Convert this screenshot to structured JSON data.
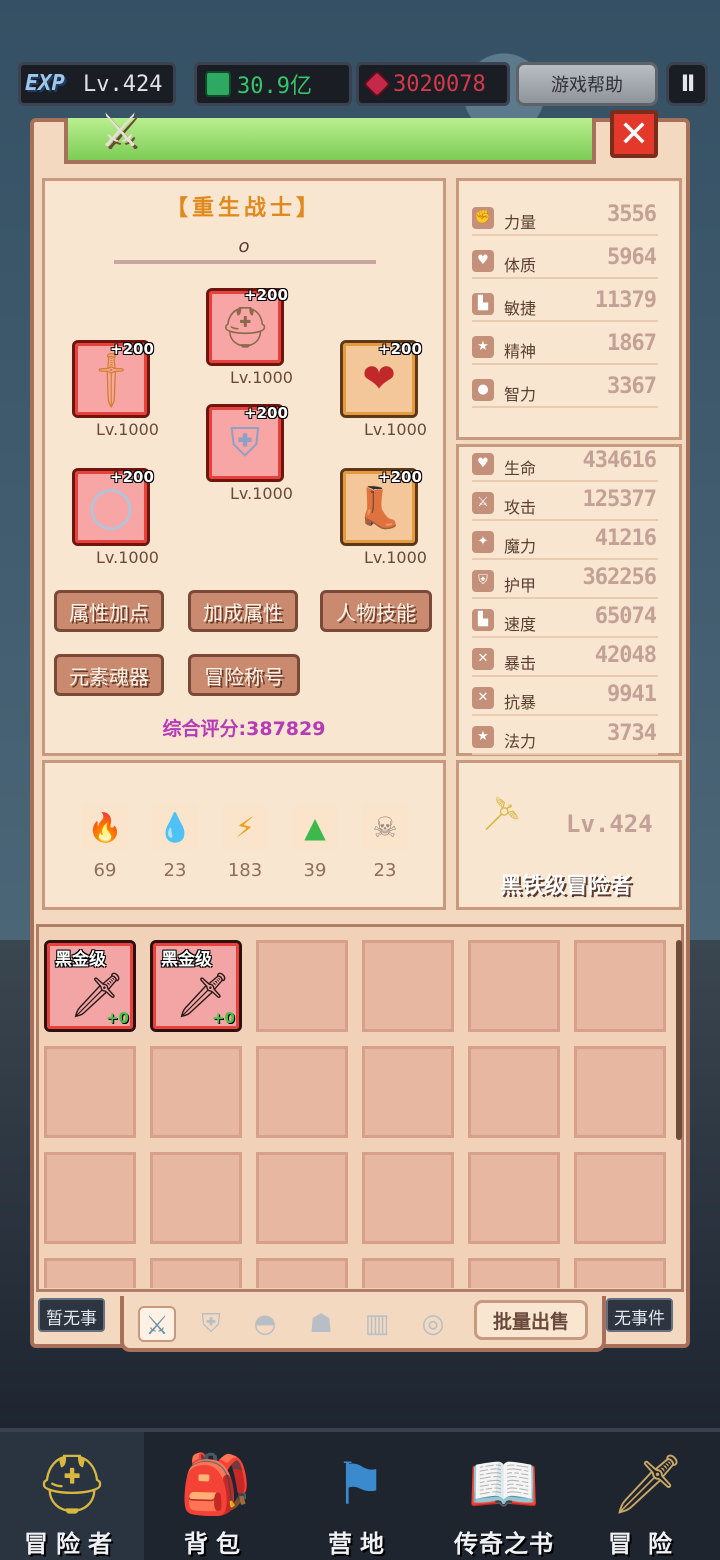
{
  "topbar": {
    "exp_badge": "EXP",
    "level": "Lv.424",
    "green_currency": "30.9亿",
    "red_currency": "3020078",
    "help_label": "游戏帮助",
    "pause_label": "II"
  },
  "panel": {
    "close_label": "✕"
  },
  "character": {
    "class_title": "【重生战士】",
    "subtitle": "o",
    "score_label": "综合评分:387829"
  },
  "equipment": [
    {
      "plus": "+200",
      "level": "Lv.1000",
      "icon": "helmet-icon"
    },
    {
      "plus": "+200",
      "level": "Lv.1000",
      "icon": "sword-icon"
    },
    {
      "plus": "+200",
      "level": "Lv.1000",
      "icon": "amulet-icon"
    },
    {
      "plus": "+200",
      "level": "Lv.1000",
      "icon": "armor-icon"
    },
    {
      "plus": "+200",
      "level": "Lv.1000",
      "icon": "ring-icon"
    },
    {
      "plus": "+200",
      "level": "Lv.1000",
      "icon": "boots-icon"
    }
  ],
  "actions": [
    "属性加点",
    "加成属性",
    "人物技能",
    "元素魂器",
    "冒险称号"
  ],
  "elements": [
    {
      "icon": "fire-icon",
      "value": "69",
      "color": "#e8421f"
    },
    {
      "icon": "water-icon",
      "value": "23",
      "color": "#3a9de0"
    },
    {
      "icon": "lightning-icon",
      "value": "183",
      "color": "#f0a020"
    },
    {
      "icon": "earth-icon",
      "value": "39",
      "color": "#3cb94a"
    },
    {
      "icon": "skull-icon",
      "value": "23",
      "color": "#9a8a80"
    }
  ],
  "attributes": [
    {
      "label": "力量",
      "value": "3556"
    },
    {
      "label": "体质",
      "value": "5964"
    },
    {
      "label": "敏捷",
      "value": "11379"
    },
    {
      "label": "精神",
      "value": "1867"
    },
    {
      "label": "智力",
      "value": "3367"
    }
  ],
  "combat_stats": [
    {
      "label": "生命",
      "value": "434616"
    },
    {
      "label": "攻击",
      "value": "125377"
    },
    {
      "label": "魔力",
      "value": "41216"
    },
    {
      "label": "护甲",
      "value": "362256"
    },
    {
      "label": "速度",
      "value": "65074"
    },
    {
      "label": "暴击",
      "value": "42048"
    },
    {
      "label": "抗暴",
      "value": "9941"
    },
    {
      "label": "法力",
      "value": "3734"
    }
  ],
  "rank": {
    "level": "Lv.424",
    "name": "黑铁级冒险者"
  },
  "inventory": {
    "items": [
      {
        "tier": "黑金级",
        "plus": "+0",
        "icon": "dark-sword-icon"
      },
      {
        "tier": "黑金级",
        "plus": "+0",
        "icon": "dark-sword-icon"
      }
    ],
    "bulk_sell_label": "批量出售"
  },
  "events": {
    "left": "暂无事",
    "right": "无事件"
  },
  "bottom_nav": [
    {
      "label": "冒险者",
      "icon": "helmet-crest-icon"
    },
    {
      "label": "背包",
      "icon": "backpack-icon"
    },
    {
      "label": "营地",
      "icon": "banner-icon"
    },
    {
      "label": "传奇之书",
      "icon": "book-icon"
    },
    {
      "label": "冒险",
      "icon": "sword-hilt-icon"
    }
  ]
}
